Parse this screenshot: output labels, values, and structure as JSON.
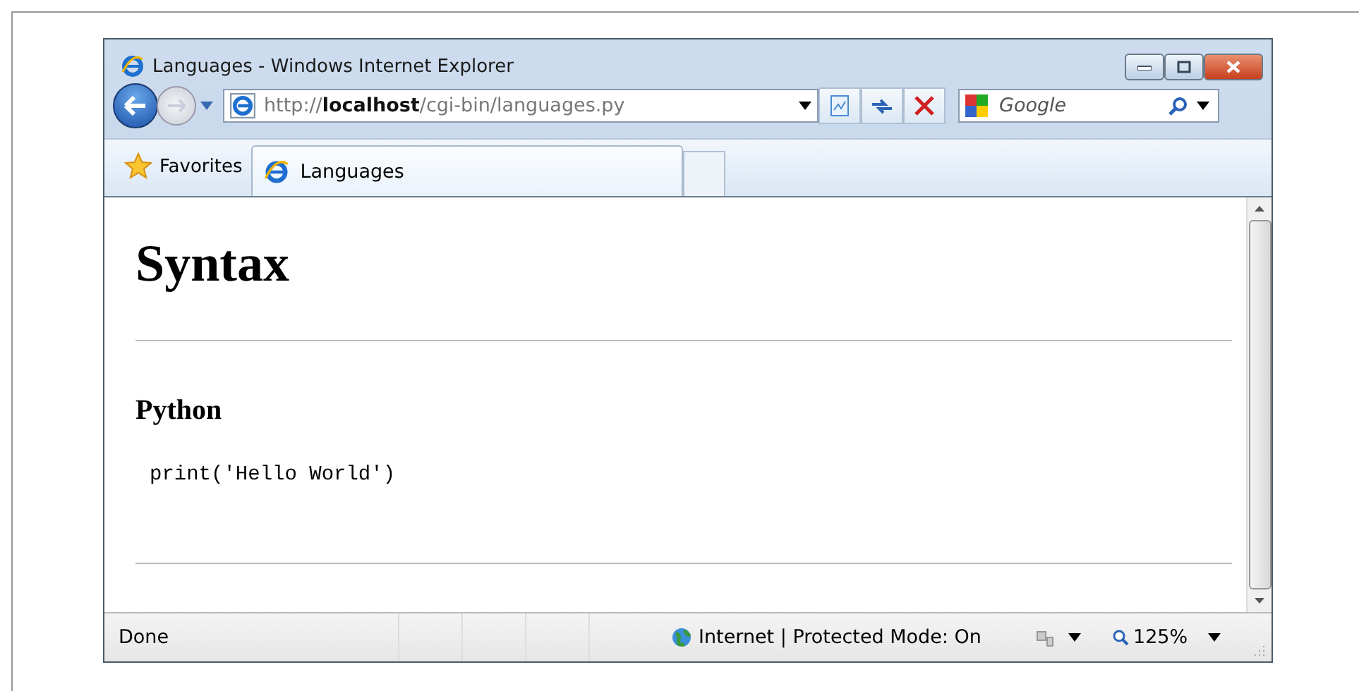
{
  "window": {
    "title": "Languages - Windows Internet Explorer"
  },
  "address_bar": {
    "value": "http://**localhost**/cgi-bin/languages.py"
  },
  "search": {
    "placeholder": "Google"
  },
  "favorites": {
    "label": "Favorites"
  },
  "tabs": [
    {
      "label": "Languages",
      "selected": true
    }
  ],
  "page": {
    "heading": "Syntax",
    "subheading": "Python",
    "code": "print('Hello World')"
  },
  "status_bar": {
    "status": "Done",
    "zone": "Internet | Protected Mode: On",
    "zoom": "125%"
  }
}
